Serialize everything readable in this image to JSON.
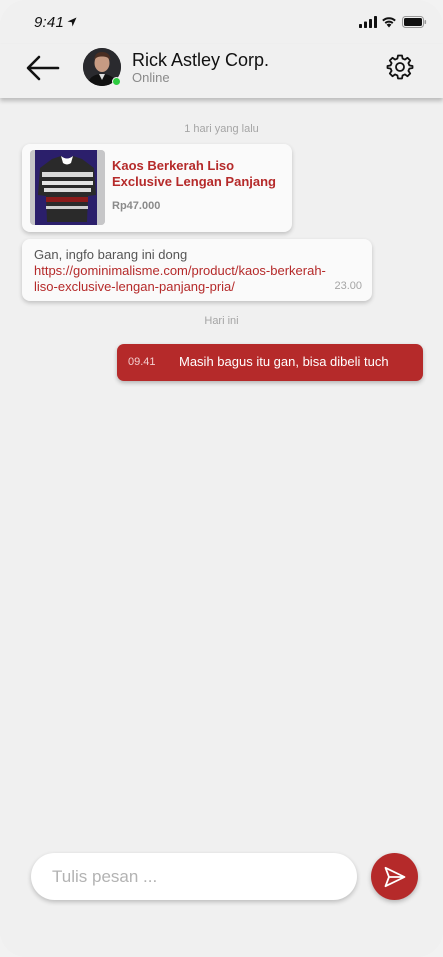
{
  "status_bar": {
    "time": "9:41",
    "icons": [
      "location-arrow-icon",
      "signal-icon",
      "wifi-icon",
      "battery-icon"
    ]
  },
  "header": {
    "back_icon": "arrow-left-icon",
    "contact_name": "Rick Astley Corp.",
    "contact_status": "Online",
    "settings_icon": "gear-icon"
  },
  "messages": {
    "divider_yesterday": "1 hari yang lalu",
    "product": {
      "title": "Kaos Berkerah Liso Exclusive Lengan Panjang",
      "price": "Rp47.000"
    },
    "incoming": {
      "text": "Gan, ingfo barang ini dong",
      "link": "https://gominimalisme.com/product/kaos-berkerah-liso-exclusive-lengan-panjang-pria/",
      "time": "23.00"
    },
    "divider_today": "Hari ini",
    "outgoing": {
      "time": "09.41",
      "text": "Masih bagus itu gan, bisa dibeli tuch"
    }
  },
  "composer": {
    "placeholder": "Tulis pesan ...",
    "send_icon": "send-icon"
  },
  "colors": {
    "accent": "#b52a2a",
    "background": "#f0f0f0",
    "online": "#2ecc40"
  }
}
